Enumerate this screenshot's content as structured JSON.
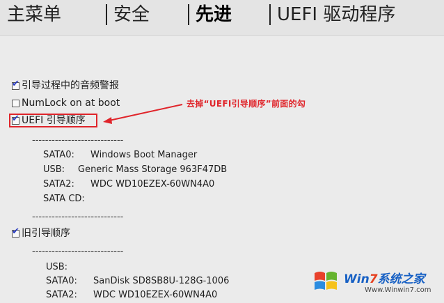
{
  "tabs": [
    {
      "label": "主菜单",
      "active": false
    },
    {
      "label": "安全",
      "active": false
    },
    {
      "label": "先进",
      "active": true
    },
    {
      "label": "UEFI 驱动程序",
      "active": false
    }
  ],
  "options": {
    "audio_alert": {
      "label": "引导过程中的音频警报",
      "checked": true
    },
    "numlock": {
      "label": "NumLock on at boot",
      "checked": false
    },
    "uefi_order": {
      "label": "UEFI 引导顺序",
      "checked": true
    },
    "legacy_order": {
      "label": "旧引导顺序",
      "checked": true
    }
  },
  "separator": "----------------------------",
  "uefi_boot_list": [
    {
      "port": "SATA0:",
      "device": "Windows Boot Manager"
    },
    {
      "port": "USB:",
      "device": "Generic Mass Storage 963F47DB"
    },
    {
      "port": "SATA2:",
      "device": "WDC WD10EZEX-60WN4A0"
    },
    {
      "port": "SATA CD:",
      "device": ""
    }
  ],
  "legacy_boot_list": [
    {
      "port": "USB:",
      "device": ""
    },
    {
      "port": "SATA0:",
      "device": "SanDisk SD8SB8U-128G-1006"
    },
    {
      "port": "SATA2:",
      "device": "WDC WD10EZEX-60WN4A0"
    }
  ],
  "annotation": "去掉“UEFI引导顺序”前面的勾",
  "annotation_color": "#e0242a",
  "watermark": {
    "brand_prefix": "Win",
    "brand_digit": "7",
    "brand_suffix": "系统之家",
    "url": "Www.Winwin7.com"
  },
  "check_color": "#2a3cc0"
}
